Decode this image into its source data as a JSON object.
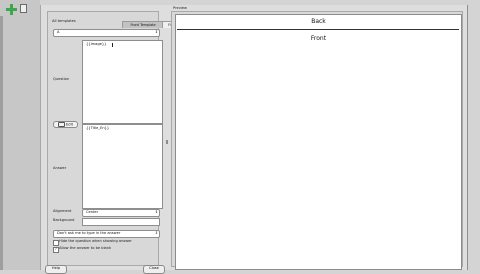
{
  "editor": {
    "tabs": [
      {
        "label": "Front Template"
      },
      {
        "label": "Fields"
      }
    ],
    "all_templates_label": "All templates",
    "template_select": {
      "value": "A"
    },
    "question_label": "Question",
    "question_text": "{{Image}}",
    "edit_button": {
      "label": "Edit"
    },
    "answer_label": "Answer",
    "answer_text": "{{Title_En}}",
    "alignment": {
      "label": "Alignment",
      "value": "Center"
    },
    "background": {
      "label": "Background",
      "value": ""
    },
    "typing_select": {
      "value": "Don't ask me to type in the answer"
    },
    "options": [
      {
        "label": "Hide the question when showing answer",
        "checked": false
      },
      {
        "label": "Allow the answer to be blank",
        "checked": true
      }
    ],
    "footer_buttons": [
      {
        "label": "Help"
      },
      {
        "label": "Close"
      }
    ]
  },
  "preview": {
    "label": "Preview",
    "back_text": "Back",
    "front_text": "Front"
  },
  "icons": {
    "add": "plus-icon",
    "doc": "document-icon",
    "edit": "edit-icon",
    "dropdown": "chevron-updown-icon",
    "checkbox_checked": "check-icon"
  },
  "colors": {
    "add_icon": "#3da84a",
    "dialog_bg": "#dedede",
    "preview_card": "#ffffff"
  }
}
